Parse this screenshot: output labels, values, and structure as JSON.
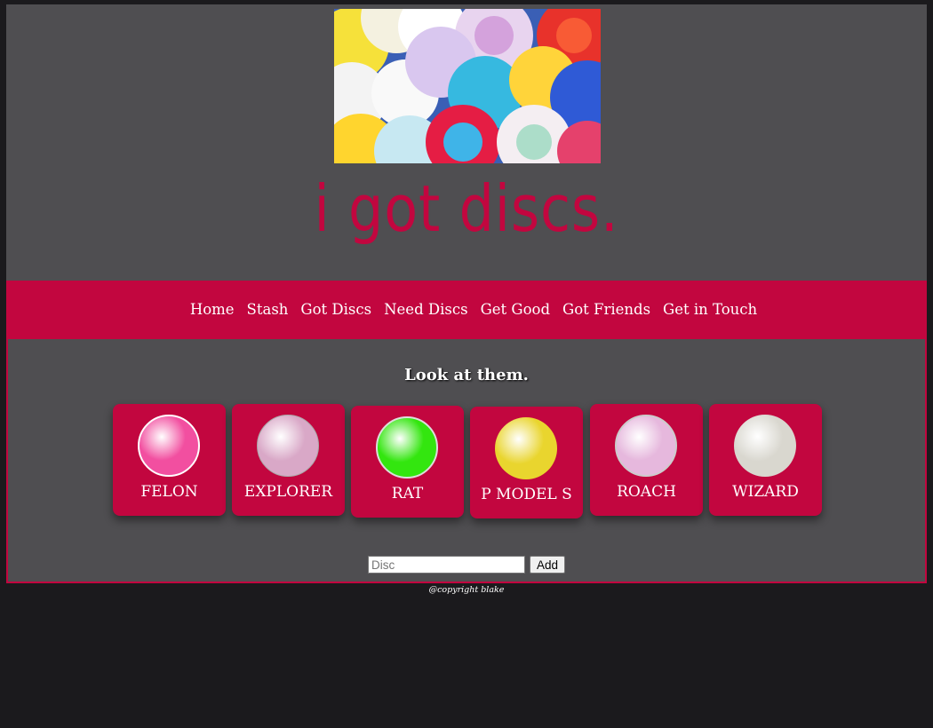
{
  "header": {
    "hero_image": "pile-of-colorful-discs-photo",
    "title": "i got discs."
  },
  "nav": {
    "items": [
      {
        "label": "Home"
      },
      {
        "label": "Stash"
      },
      {
        "label": "Got Discs"
      },
      {
        "label": "Need Discs"
      },
      {
        "label": "Get Good"
      },
      {
        "label": "Got Friends"
      },
      {
        "label": "Get in Touch"
      }
    ]
  },
  "main": {
    "heading": "Look at them.",
    "discs": [
      {
        "name": "FELON",
        "color": "#f24fa0"
      },
      {
        "name": "EXPLORER",
        "color": "#d9a8c7"
      },
      {
        "name": "RAT",
        "color": "#33e60f"
      },
      {
        "name": "P MODEL S",
        "color": "#e9d52e"
      },
      {
        "name": "ROACH",
        "color": "#e6b8dd"
      },
      {
        "name": "WIZARD",
        "color": "#d9d7cf"
      }
    ],
    "add_form": {
      "placeholder": "Disc",
      "button_label": "Add"
    }
  },
  "footer": {
    "text": "@copyright blake"
  },
  "colors": {
    "accent": "#c2063f",
    "panel": "#4f4e51",
    "background": "#1b1a1d"
  }
}
